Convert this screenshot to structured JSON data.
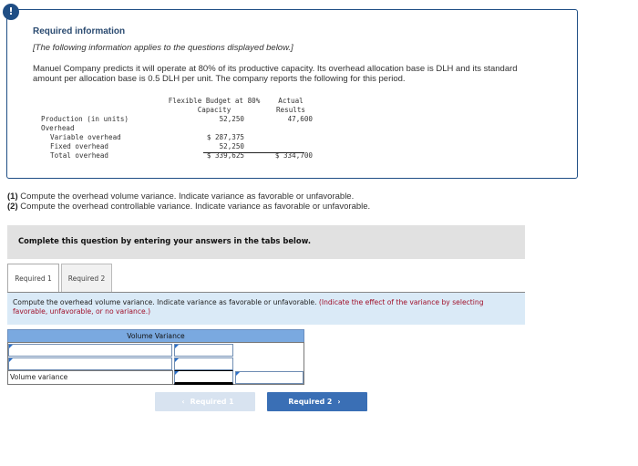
{
  "info": {
    "badge_icon": "!",
    "title": "Required information",
    "intro": "[The following information applies to the questions displayed below.]",
    "paragraph": "Manuel Company predicts it will operate at 80% of its productive capacity. Its overhead allocation base is DLH and its standard amount per allocation base is 0.5 DLH per unit. The company reports the following for this period."
  },
  "data_table": {
    "col1_header_line1": "Flexible Budget at 80%",
    "col1_header_line2": "Capacity",
    "col2_header_line1": "Actual",
    "col2_header_line2": "Results",
    "rows": [
      {
        "label": "Production (in units)",
        "budget": "52,250",
        "actual": "47,600"
      },
      {
        "label": "Overhead",
        "budget": "",
        "actual": ""
      },
      {
        "label": "Variable overhead",
        "budget": "$ 287,375",
        "actual": ""
      },
      {
        "label": "Fixed overhead",
        "budget": "52,250",
        "actual": ""
      },
      {
        "label": "Total overhead",
        "budget": "$ 339,625",
        "actual": "$ 334,700"
      }
    ]
  },
  "questions": [
    {
      "num": "(1)",
      "text": " Compute the overhead volume variance. Indicate variance as favorable or unfavorable."
    },
    {
      "num": "(2)",
      "text": " Compute the overhead controllable variance. Indicate variance as favorable or unfavorable."
    }
  ],
  "banner": "Complete this question by entering your answers in the tabs below.",
  "tabs": [
    {
      "label": "Required 1",
      "active": true
    },
    {
      "label": "Required 2",
      "active": false
    }
  ],
  "instruction": {
    "text": "Compute the overhead volume variance. Indicate variance as favorable or unfavorable. ",
    "hint": "(Indicate the effect of the variance by selecting favorable, unfavorable, or no variance.)"
  },
  "answer_table": {
    "header": "Volume Variance",
    "row3_label": "Volume variance",
    "inputs": [
      "",
      "",
      "",
      "",
      "",
      ""
    ]
  },
  "nav": {
    "prev_label": "Required 1",
    "next_label": "Required 2",
    "prev_icon": "‹",
    "next_icon": "›"
  },
  "colors": {
    "accent": "#1f4e85",
    "button_primary": "#3a6fb5",
    "button_disabled": "#d8e3f0",
    "table_header": "#7aa9e0",
    "hint_red": "#a0102a"
  }
}
